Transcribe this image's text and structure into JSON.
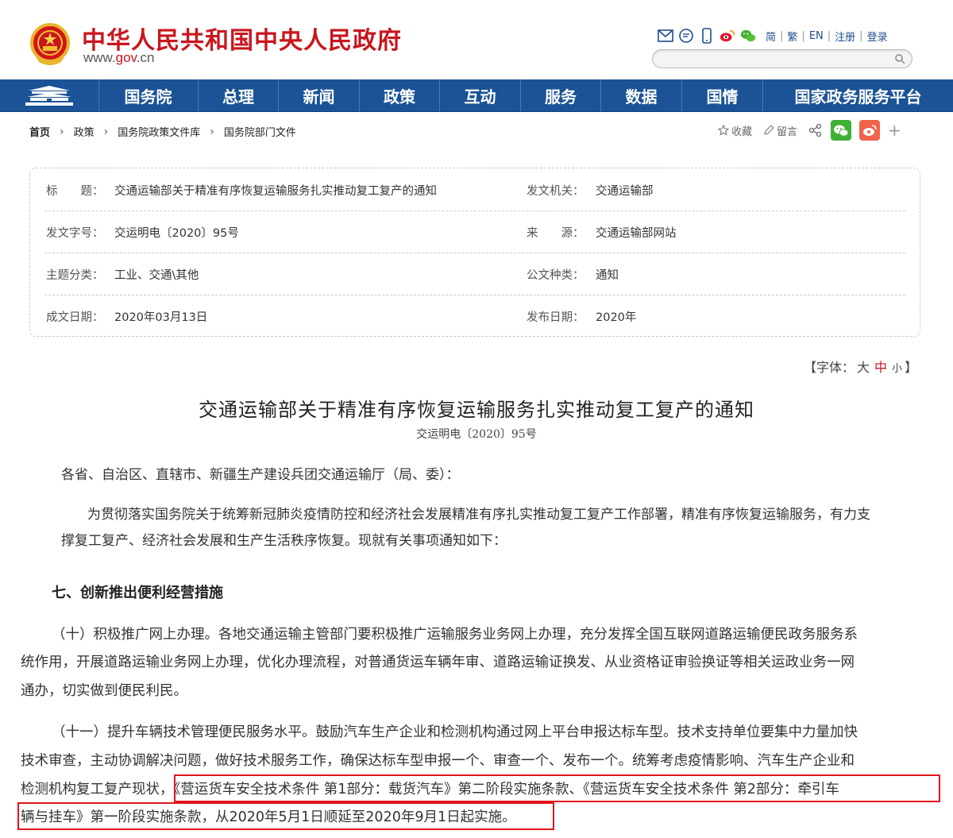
{
  "header": {
    "site_name": "中华人民共和国中央人民政府",
    "site_url_prefix": "www.",
    "site_url_highlight": "gov",
    "site_url_suffix": ".cn",
    "lang_links": [
      "简",
      "繁",
      "EN",
      "注册",
      "登录"
    ],
    "search_placeholder": ""
  },
  "nav": {
    "items": [
      "国务院",
      "总理",
      "新闻",
      "政策",
      "互动",
      "服务",
      "数据",
      "国情",
      "国家政务服务平台"
    ]
  },
  "breadcrumb": [
    "首页",
    "政策",
    "国务院政策文件库",
    "国务院部门文件"
  ],
  "share": {
    "favorite": "收藏",
    "comment": "留言",
    "plus": "+"
  },
  "meta": {
    "title_label": "标　　题：",
    "title_value": "交通运输部关于精准有序恢复运输服务扎实推动复工复产的通知",
    "issuer_label": "发文机关：",
    "issuer_value": "交通运输部",
    "doc_no_label": "发文字号：",
    "doc_no_value": "交运明电〔2020〕95号",
    "source_label": "来　　源：",
    "source_value": "交通运输部网站",
    "topic_label": "主题分类：",
    "topic_value": "工业、交通\\其他",
    "type_label": "公文种类：",
    "type_value": "通知",
    "written_label": "成文日期：",
    "written_value": "2020年03月13日",
    "published_label": "发布日期：",
    "published_value": "2020年"
  },
  "font_size": {
    "prefix": "【字体：",
    "large": "大",
    "medium": "中",
    "small": "小",
    "suffix": "】"
  },
  "article": {
    "title": "交通运输部关于精准有序恢复运输服务扎实推动复工复产的通知",
    "doc_no": "交运明电〔2020〕95号",
    "salutation": "各省、自治区、直辖市、新疆生产建设兵团交通运输厅（局、委）：",
    "intro_line1": "为贯彻落实国务院关于统筹新冠肺炎疫情防控和经济社会发展精准有序扎实推动复工复产工作部署，精准有序恢复运输服务，有力支",
    "intro_line2": "撑复工复产、经济社会发展和生产生活秩序恢复。现就有关事项通知如下：",
    "section_heading": "七、创新推出便利经营措施",
    "p10_line1": "（十）积极推广网上办理。各地交通运输主管部门要积极推广运输服务业务网上办理，充分发挥全国互联网道路运输便民政务服务系",
    "p10_line2": "统作用，开展道路运输业务网上办理，优化办理流程，对普通货运车辆年审、道路运输证换发、从业资格证审验换证等相关运政业务一网",
    "p10_line3": "通办，切实做到便民利民。",
    "p11_line1": "（十一）提升车辆技术管理便民服务水平。鼓励汽车生产企业和检测机构通过网上平台申报达标车型。技术支持单位要集中力量加快",
    "p11_line2": "技术审查，主动协调解决问题，做好技术服务工作，确保达标车型申报一个、审查一个、发布一个。统筹考虑疫情影响、汽车生产企业和",
    "p11_line3": "检测机构复工复产现状，《营运货车安全技术条件 第1部分：载货汽车》第二阶段实施条款、《营运货车安全技术条件 第2部分：牵引车",
    "p11_line4": "辆与挂车》第一阶段实施条款，从2020年5月1日顺延至2020年9月1日起实施。"
  },
  "colors": {
    "brand_red": "#c8161e",
    "nav_blue": "#1b5396",
    "highlight_box": "#e0141c"
  }
}
